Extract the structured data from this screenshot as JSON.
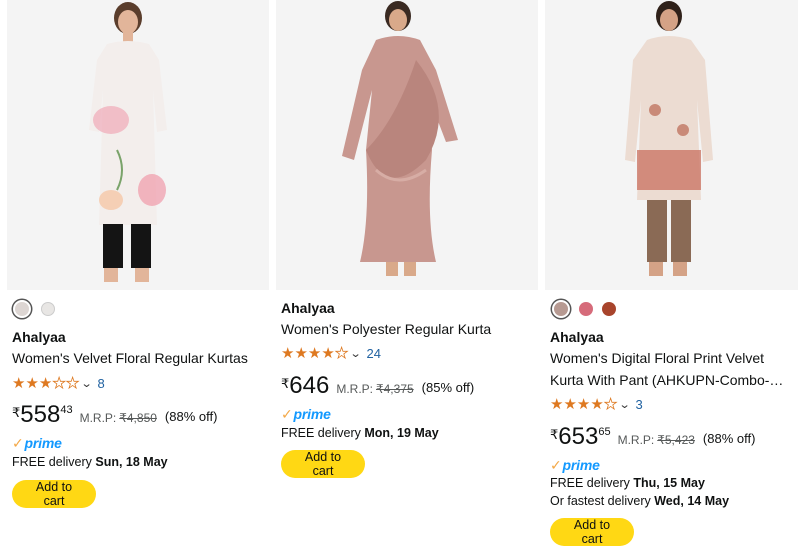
{
  "products": [
    {
      "brand": "Ahalyaa",
      "title_lines": [
        "Women's Velvet Floral Regular Kurtas"
      ],
      "rating": 3.0,
      "rating_count": "8",
      "price_symbol": "₹",
      "price_whole": "558",
      "price_fraction": "43",
      "mrp_label": "M.R.P:",
      "mrp_value": "₹4,850",
      "discount": "(88% off)",
      "prime_label": "prime",
      "delivery_prefix": "FREE delivery",
      "delivery_date": "Sun, 18 May",
      "fastest_prefix": "",
      "fastest_date": "",
      "cart_label": "Add to cart",
      "swatch_colors": [
        "#ddd6d3",
        "#e8e6e4"
      ],
      "image_icon": "white-floral-kurta-image"
    },
    {
      "brand": "Ahalyaa",
      "title_lines": [
        "Women's Polyester Regular Kurta"
      ],
      "rating": 4.0,
      "rating_count": "24",
      "price_symbol": "₹",
      "price_whole": "646",
      "price_fraction": "",
      "mrp_label": "M.R.P:",
      "mrp_value": "₹4,375",
      "discount": "(85% off)",
      "prime_label": "prime",
      "delivery_prefix": "FREE delivery",
      "delivery_date": "Mon, 19 May",
      "fastest_prefix": "",
      "fastest_date": "",
      "cart_label": "Add to cart",
      "swatch_colors": [],
      "image_icon": "pink-drape-kurta-image"
    },
    {
      "brand": "Ahalyaa",
      "title_lines": [
        "Women's Digital Floral Print Velvet",
        "Kurta With Pant (AHKUPN-Combo-…"
      ],
      "rating": 4.0,
      "rating_count": "3",
      "price_symbol": "₹",
      "price_whole": "653",
      "price_fraction": "65",
      "mrp_label": "M.R.P:",
      "mrp_value": "₹5,423",
      "discount": "(88% off)",
      "prime_label": "prime",
      "delivery_prefix": "FREE delivery",
      "delivery_date": "Thu, 15 May",
      "fastest_prefix": "Or fastest delivery",
      "fastest_date": "Wed, 14 May",
      "cart_label": "Add to cart",
      "swatch_colors": [
        "#b79a92",
        "#d66b7a",
        "#a8442c"
      ],
      "image_icon": "printed-kurta-pant-image"
    }
  ]
}
